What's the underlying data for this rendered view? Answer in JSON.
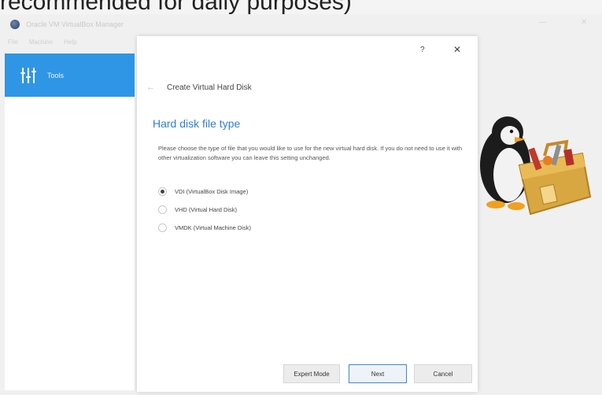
{
  "caption": "recommended for daily purposes)",
  "manager": {
    "title": "Oracle VM VirtualBox Manager",
    "menu": [
      "File",
      "Machine",
      "Help"
    ],
    "controls": {
      "minimize": "—",
      "close": "✕"
    },
    "sidebar": {
      "tools_label": "Tools",
      "tools_icon": "tools-icon"
    }
  },
  "dialog": {
    "help": "?",
    "close": "✕",
    "back": "←",
    "title": "Create Virtual Hard Disk",
    "section_title": "Hard disk file type",
    "description": "Please choose the type of file that you would like to use for the new virtual hard disk. If you do not need to use it with other virtualization software you can leave this setting unchanged.",
    "options": [
      {
        "label": "VDI (VirtualBox Disk Image)",
        "checked": true
      },
      {
        "label": "VHD (Virtual Hard Disk)",
        "checked": false
      },
      {
        "label": "VMDK (Virtual Machine Disk)",
        "checked": false
      }
    ],
    "buttons": {
      "expert": "Expert Mode",
      "next": "Next",
      "cancel": "Cancel"
    }
  },
  "colors": {
    "accent": "#2f96e6",
    "section_title": "#2f7fd0",
    "default_button_border": "#3d86cf"
  }
}
